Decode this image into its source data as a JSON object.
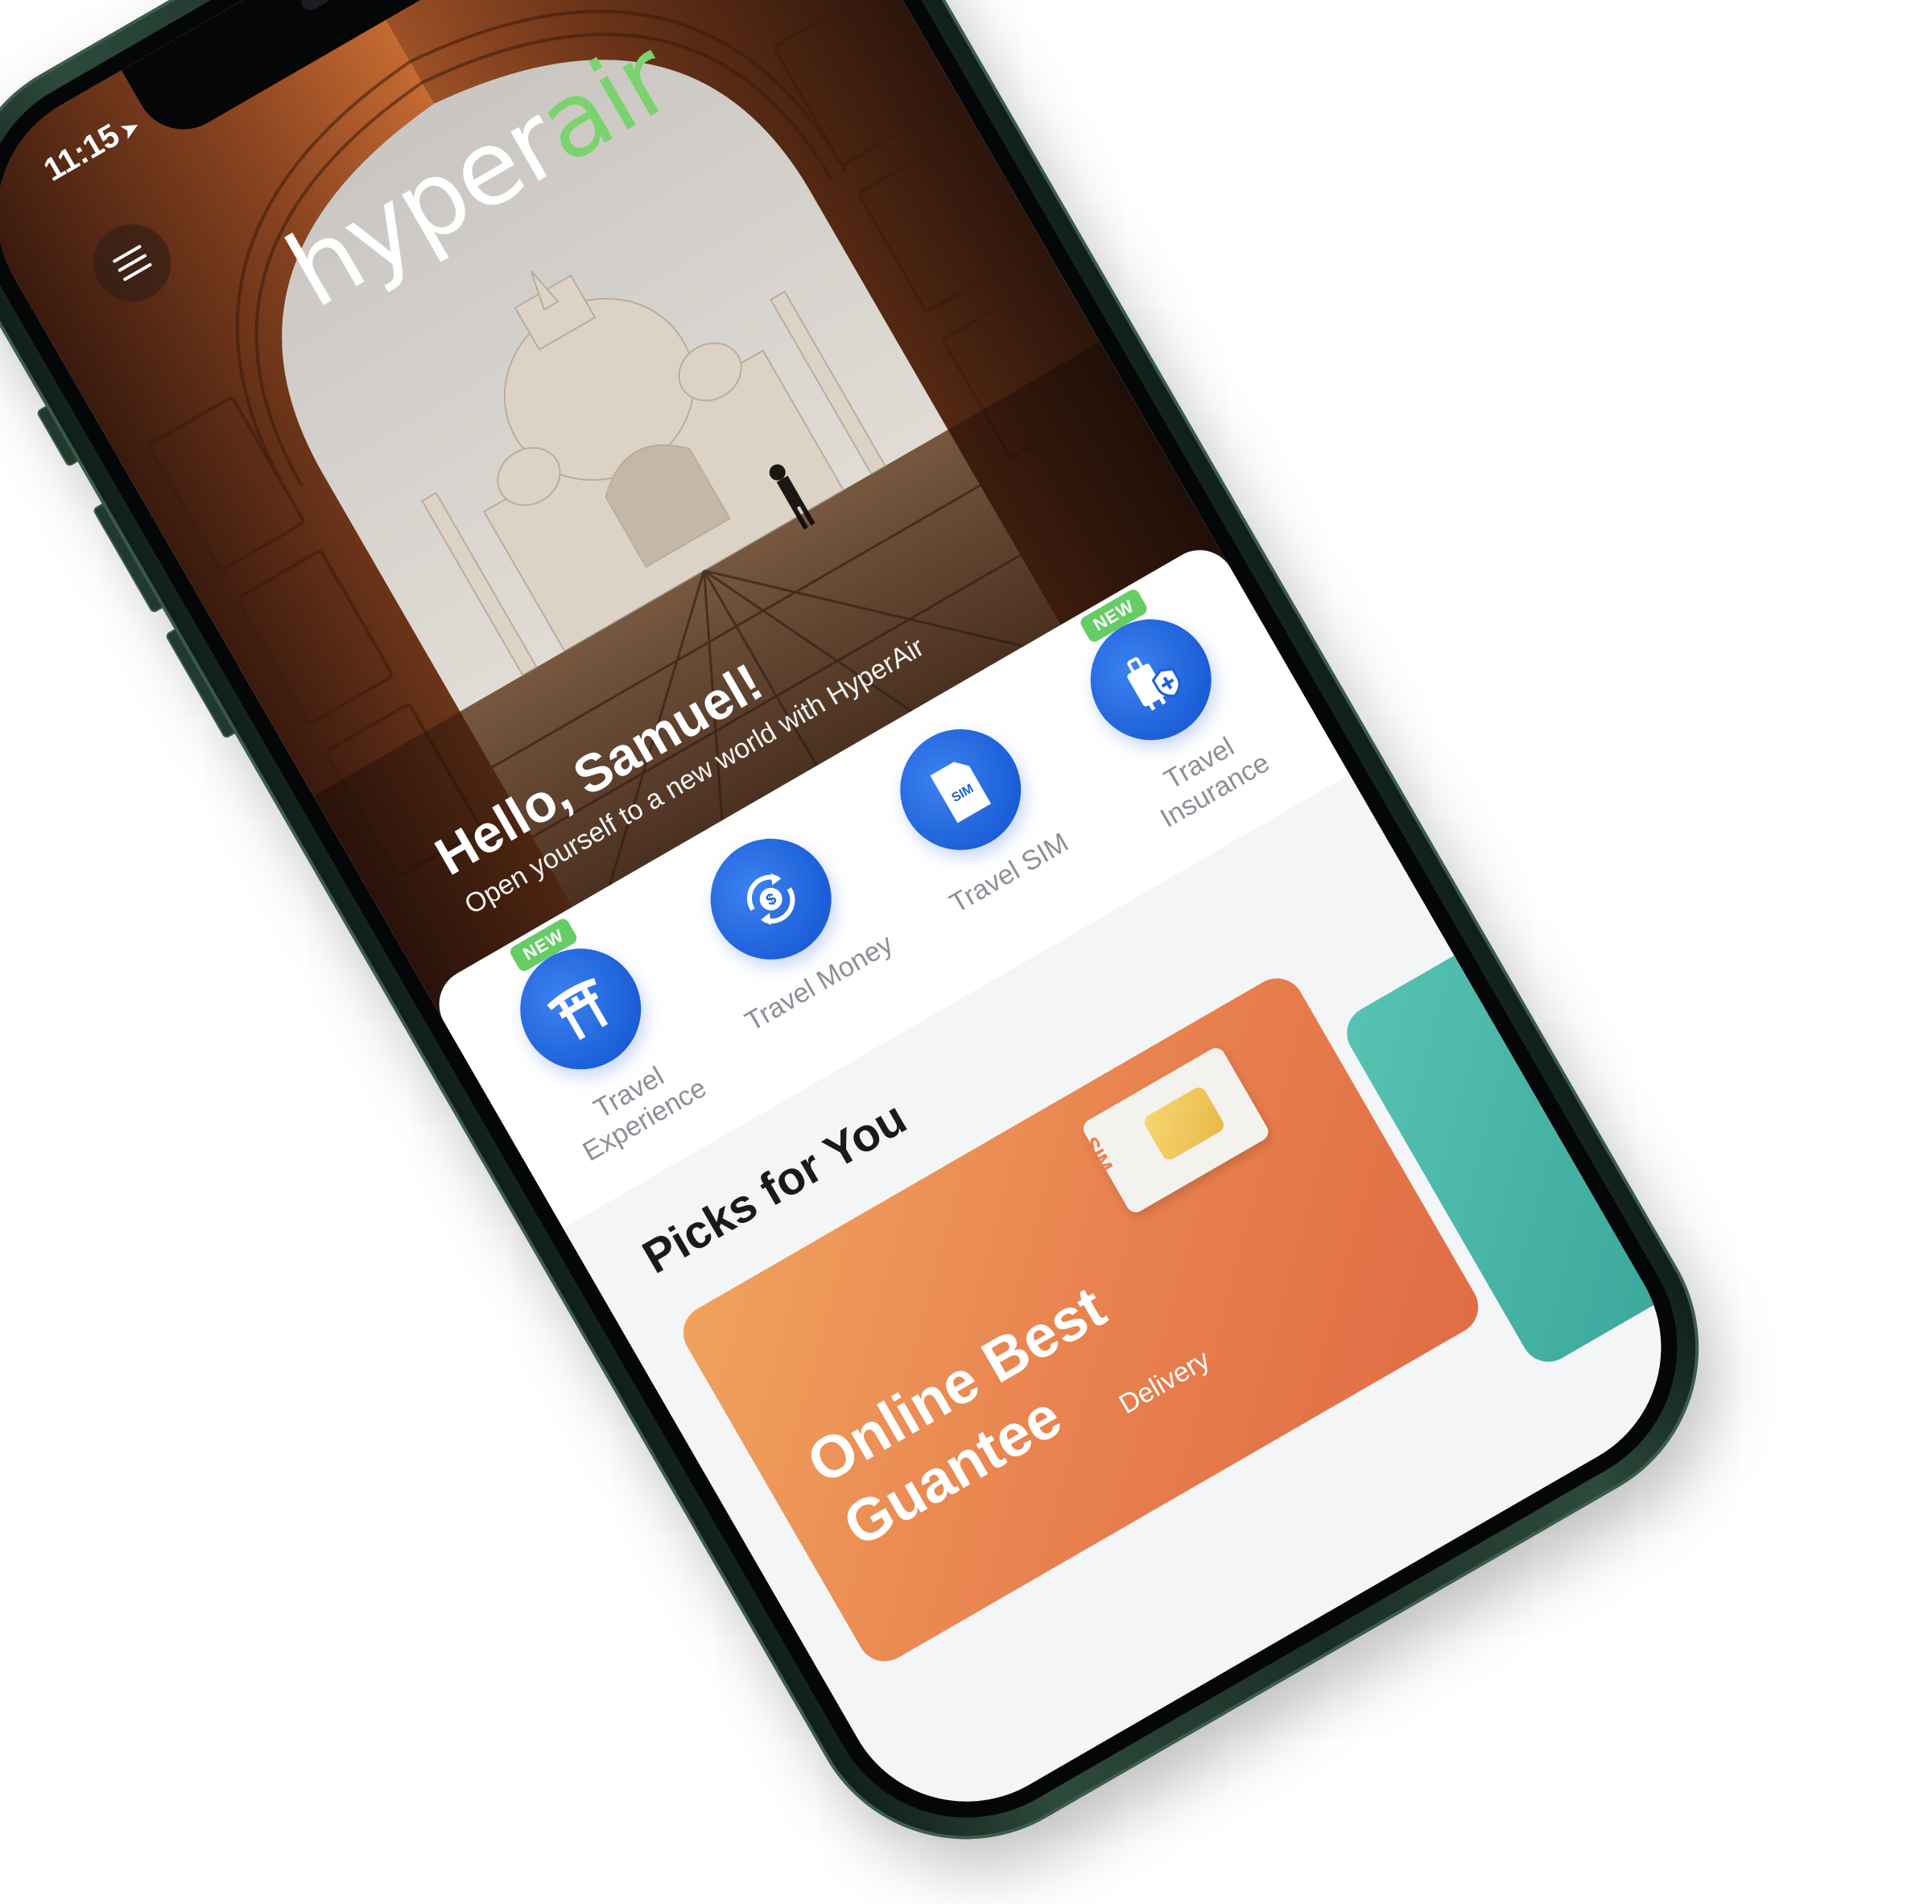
{
  "status_bar": {
    "time": "11:15",
    "location_icon": "location-arrow-icon",
    "signal_icon": "cellular-signal-icon",
    "wifi_icon": "wifi-icon",
    "battery_icon": "battery-icon"
  },
  "header": {
    "menu_icon": "hamburger-menu-icon",
    "logo": {
      "part1": "hyper",
      "part2": "air"
    }
  },
  "greeting": {
    "title": "Hello, Samuel!",
    "subtitle": "Open yourself to a new world with HyperAir"
  },
  "services": [
    {
      "label": "Travel Experience",
      "icon": "torii-gate-icon",
      "badge": "NEW"
    },
    {
      "label": "Travel Money",
      "icon": "currency-exchange-icon",
      "badge": ""
    },
    {
      "label": "Travel SIM",
      "icon": "sim-card-icon",
      "badge": ""
    },
    {
      "label": "Travel Insurance",
      "icon": "luggage-shield-icon",
      "badge": "NEW"
    }
  ],
  "picks": {
    "title": "Picks for You",
    "promo": {
      "line1": "Online Best",
      "line2": "Guantee",
      "line3": "Delivery",
      "sim_label": "SIM"
    }
  },
  "colors": {
    "accent_green": "#7ad36e",
    "service_blue": "#1c5fd8",
    "badge_green": "#66cc66",
    "promo_orange": "#e8804e",
    "device_frame": "#1a2e25"
  }
}
